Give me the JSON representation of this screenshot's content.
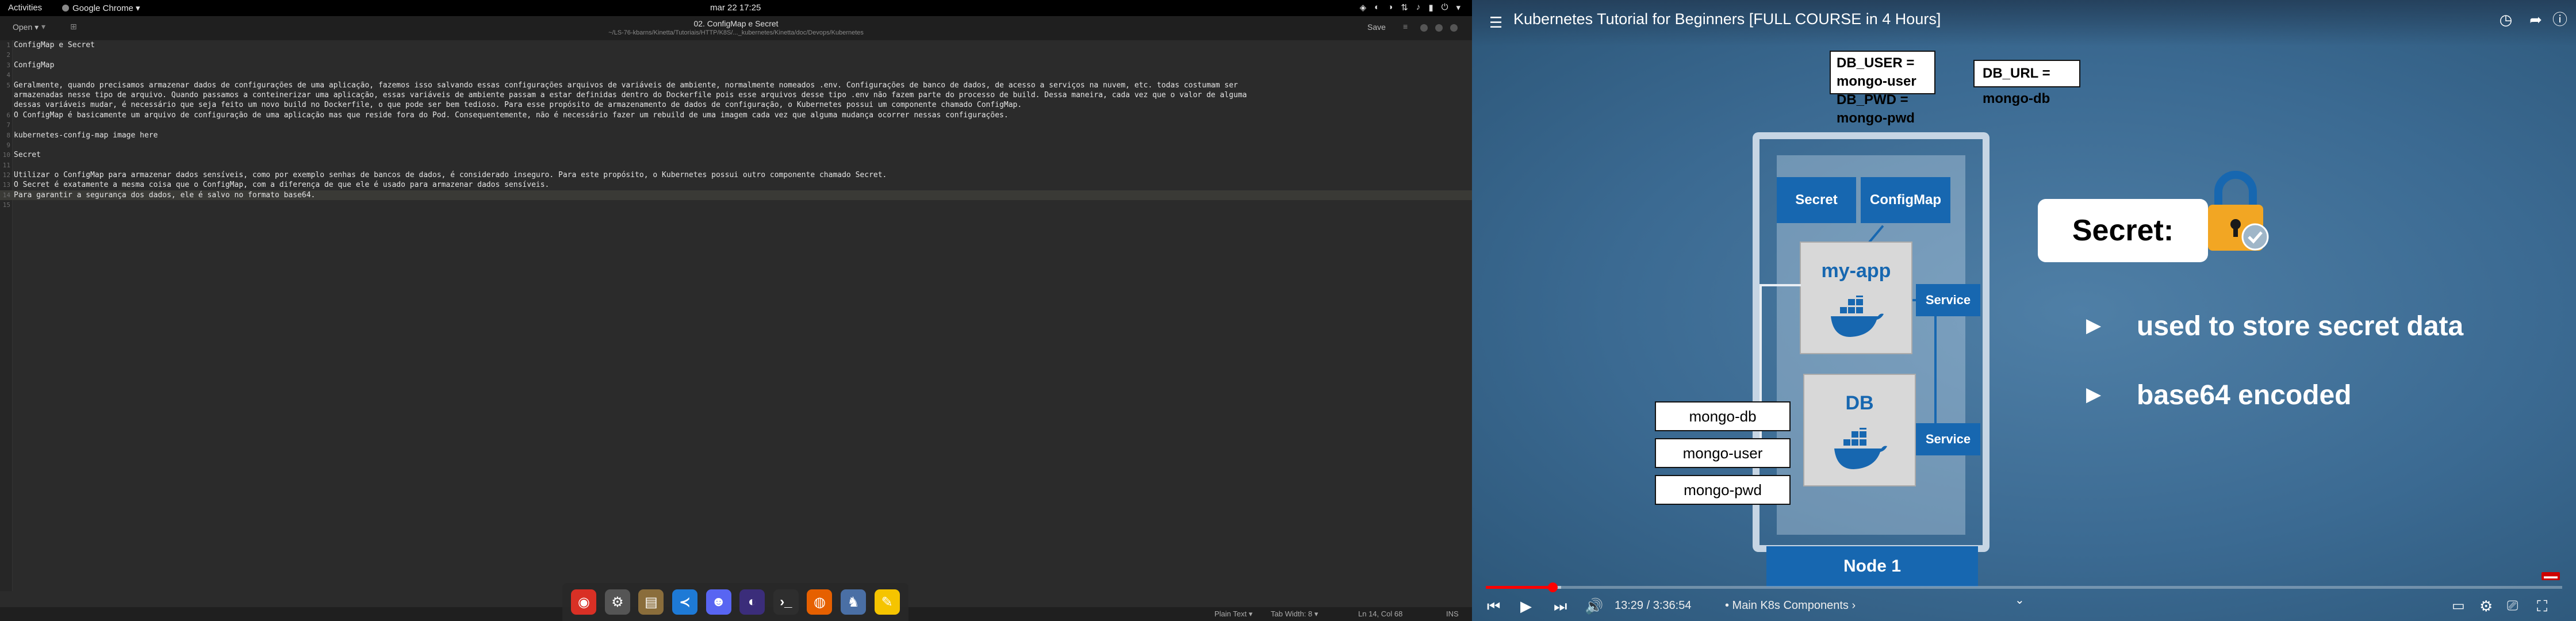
{
  "topbar": {
    "activities": "Activities",
    "app_menu": "Google Chrome ▾",
    "clock": "mar 22  17:25"
  },
  "gedit": {
    "open_label": "Open",
    "title": "02. ConfigMap e Secret",
    "subtitle": "~/LS-76-kbarns/Kinetta/Tutoriais/HTTP/K8S/..._kubernetes/Kinetta/doc/Devops/Kubernetes",
    "save_label": "Save",
    "lines": [
      {
        "n": "1",
        "text": "ConfigMap e Secret"
      },
      {
        "n": "2",
        "text": ""
      },
      {
        "n": "3",
        "text": "ConfigMap"
      },
      {
        "n": "4",
        "text": ""
      },
      {
        "n": "5",
        "text": "Geralmente, quando precisamos armazenar dados de configurações de uma aplicação, fazemos isso salvando essas configurações arquivos de variáveis de ambiente, normalmente nomeados .env. Configurações de banco de dados, de acesso a serviços na nuvem, etc. todas costumam ser"
      },
      {
        "n": "",
        "text": "armazenadas nesse tipo de arquivo. Quando passamos a conteinerizar uma aplicação, essas variáveis de ambiente passam a estar definidas dentro do Dockerfile pois esse arquivos desse tipo .env não fazem parte do processo de build. Dessa maneira, cada vez que o valor de alguma"
      },
      {
        "n": "",
        "text": "dessas variáveis mudar, é necessário que seja feito um novo build no Dockerfile, o que pode ser bem tedioso. Para esse propósito de armazenamento de dados de configuração, o Kubernetes possui um componente chamado ConfigMap."
      },
      {
        "n": "6",
        "text": "O ConfigMap é basicamente um arquivo de configuração de uma aplicação mas que reside fora do Pod. Consequentemente, não é necessário fazer um rebuild de uma imagem cada vez que alguma mudança ocorrer nessas configurações."
      },
      {
        "n": "7",
        "text": ""
      },
      {
        "n": "8",
        "text": "kubernetes-config-map image here"
      },
      {
        "n": "9",
        "text": ""
      },
      {
        "n": "10",
        "text": "Secret"
      },
      {
        "n": "11",
        "text": ""
      },
      {
        "n": "12",
        "text": "Utilizar o ConfigMap para armazenar dados sensíveis, como por exemplo senhas de bancos de dados, é considerado inseguro. Para este propósito, o Kubernetes possui outro componente chamado Secret."
      },
      {
        "n": "13",
        "text": "O Secret é exatamente a mesma coisa que o ConfigMap, com a diferença de que ele é usado para armazenar dados sensíveis."
      },
      {
        "n": "14",
        "text": "Para garantir a segurança dos dados, ele é salvo no formato base64."
      },
      {
        "n": "15",
        "text": ""
      }
    ],
    "status": {
      "language": "Plain Text ▾",
      "tab_width": "Tab Width: 8 ▾",
      "position": "Ln 14, Col 68",
      "mode": "INS"
    }
  },
  "dock": {
    "apps": [
      {
        "name": "chrome",
        "glyph": "◉",
        "color": "#d93025"
      },
      {
        "name": "settings",
        "glyph": "⚙",
        "color": "#555555"
      },
      {
        "name": "archive",
        "glyph": "▤",
        "color": "#8a6d3b"
      },
      {
        "name": "vscode",
        "glyph": "≺",
        "color": "#1e7ad6"
      },
      {
        "name": "discord",
        "glyph": "☻",
        "color": "#5865f2"
      },
      {
        "name": "eclipse",
        "glyph": "◐",
        "color": "#3b2d7a"
      },
      {
        "name": "terminal",
        "glyph": "›_",
        "color": "#2e2e2e"
      },
      {
        "name": "firefox",
        "glyph": "◍",
        "color": "#e66000"
      },
      {
        "name": "robot",
        "glyph": "♞",
        "color": "#4a6fa5"
      },
      {
        "name": "notes",
        "glyph": "✎",
        "color": "#f5c400"
      }
    ]
  },
  "youtube": {
    "title": "Kubernetes Tutorial for Beginners [FULL COURSE in 4 Hours]",
    "slide": {
      "db_user": "DB_USER = mongo-user",
      "db_pwd": "DB_PWD = mongo-pwd",
      "db_url": "DB_URL = mongo-db",
      "secret_box": "Secret",
      "configmap_box": "ConfigMap",
      "my_app": "my-app",
      "db": "DB",
      "service_1": "Service",
      "service_2": "Service",
      "label_mongo_db": "mongo-db",
      "label_mongo_user": "mongo-user",
      "label_mongo_pwd": "mongo-pwd",
      "node": "Node 1",
      "secret_card": "Secret:",
      "bullet_1": "used to store secret data",
      "bullet_2": "base64 encoded"
    },
    "time": "13:29 / 3:36:54",
    "chapter": "• Main K8s Components ›",
    "progress": 0.062,
    "buffered": 0.07,
    "brand_red": "#ff0000",
    "slide_blue": "#1767b0"
  }
}
